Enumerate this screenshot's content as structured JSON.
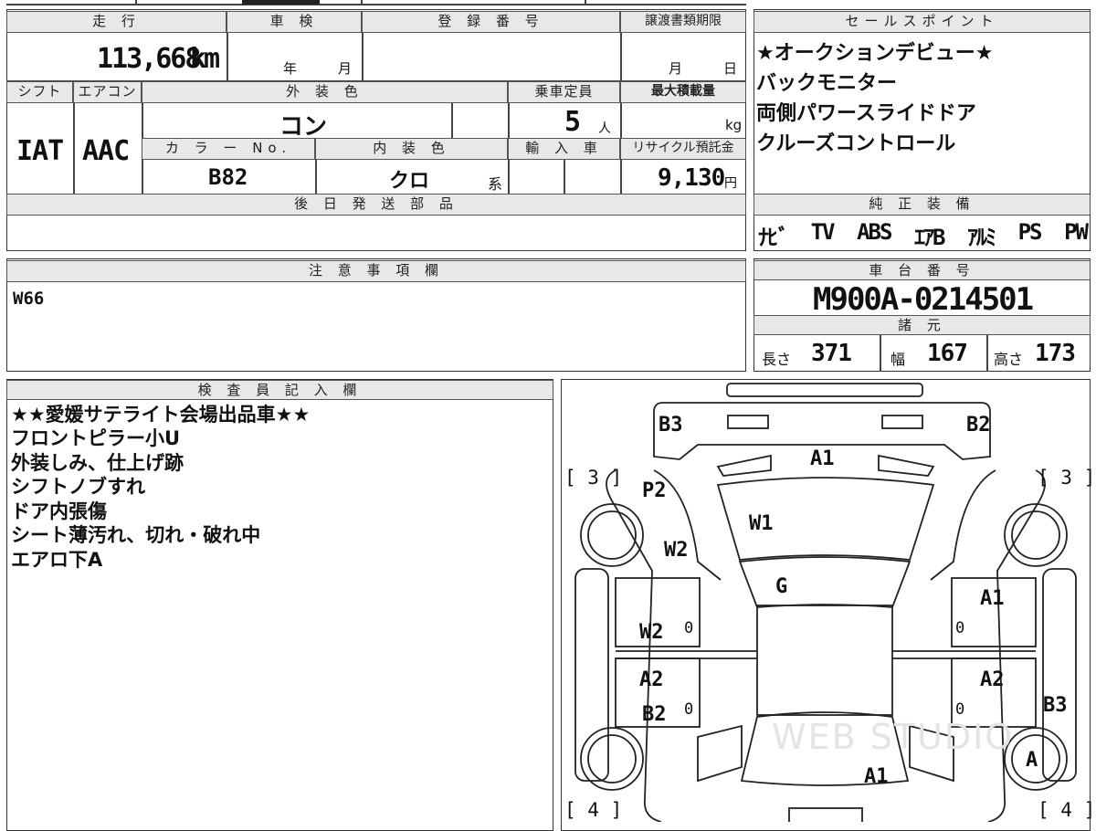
{
  "top": {
    "mileage_header": "走 行",
    "mileage": "113,668",
    "mileage_unit": "km",
    "shaken_header": "車 検",
    "shaken_year": "年",
    "shaken_month": "月",
    "reg_header": "登 録 番 号",
    "transfer_header": "譲渡書類期限",
    "transfer_month": "月",
    "transfer_day": "日"
  },
  "row2": {
    "shift_header": "シフト",
    "shift": "IAT",
    "ac_header": "エアコン",
    "ac": "AAC",
    "exterior_header": "外 装 色",
    "exterior": "コン",
    "capacity_header": "乗車定員",
    "capacity": "5",
    "capacity_unit": "人",
    "maxload_header": "最大積載量",
    "maxload_unit": "kg",
    "color_no_header": "カ ラ ー No.",
    "color_no": "B82",
    "interior_header": "内 装 色",
    "interior": "クロ",
    "interior_suffix": "系",
    "import_header": "輸 入 車",
    "recycle_header": "リサイクル預託金",
    "recycle": "9,130",
    "recycle_unit": "円"
  },
  "later_parts": {
    "header": "後 日 発 送 部 品",
    "value": ""
  },
  "sales_points": {
    "header": "セールスポイント",
    "items": [
      "★オークションデビュー★",
      "バックモニター",
      "両側パワースライドドア",
      "クルーズコントロール"
    ]
  },
  "equipment": {
    "header": "純 正 装 備",
    "items": [
      "ﾅﾋﾞ",
      "TV",
      "ABS",
      "ｴｱB",
      "ｱﾙﾐ",
      "PS",
      "PW"
    ]
  },
  "caution": {
    "header": "注 意 事 項 欄",
    "value": "W66"
  },
  "chassis": {
    "header": "車 台 番 号",
    "value": "M900A-0214501"
  },
  "specs": {
    "header": "諸 元",
    "length_label": "長さ",
    "length": "371",
    "width_label": "幅",
    "width": "167",
    "height_label": "高さ",
    "height": "173"
  },
  "inspector": {
    "header": "検 査 員 記 入 欄",
    "lines": [
      "★★愛媛サテライト会場出品車★★",
      "フロントピラー小U",
      "外装しみ、仕上げ跡",
      "シフトノブすれ",
      "ドア内張傷",
      "シート薄汚れ、切れ・破れ中",
      "エアロ下A"
    ]
  },
  "diagram": {
    "marks": {
      "b3_top": "B3",
      "b2_top": "B2",
      "a1_top": "A1",
      "p2": "P2",
      "w1": "W1",
      "w2_left": "W2",
      "g": "G",
      "w2_door": "W2",
      "a2_left": "A2",
      "b2_left": "B2",
      "a1_right": "A1",
      "a2_right": "A2",
      "b3_right": "B3",
      "a_wheel": "A",
      "a1_bottom": "A1"
    },
    "zeros": [
      "0",
      "0",
      "0",
      "0"
    ],
    "corner_tl": "[ 3 ]",
    "corner_tr": "[ 3 ]",
    "corner_bl": "[ 4 ]",
    "corner_br": "[ 4 ]",
    "watermark": "WEB STUDIO"
  }
}
